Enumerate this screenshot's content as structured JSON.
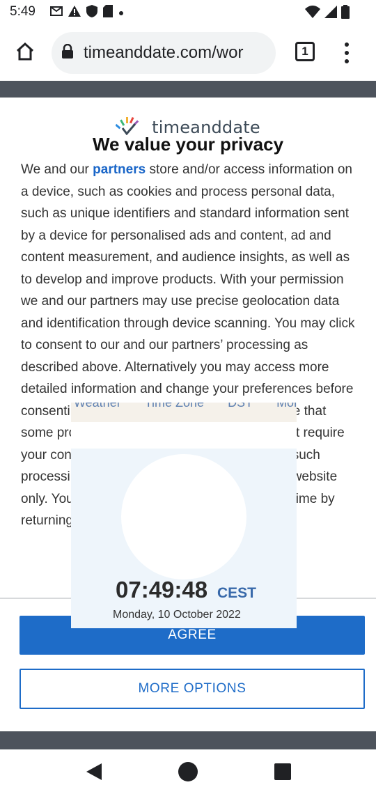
{
  "status_bar": {
    "time": "5:49",
    "icons_left": [
      "gmail-icon",
      "alert-icon",
      "shield-icon",
      "sd-card-icon",
      "dot-icon"
    ],
    "icons_right": [
      "wifi-icon",
      "signal-icon",
      "battery-icon"
    ]
  },
  "browser": {
    "url": "timeanddate.com/wor",
    "tab_count": "1"
  },
  "consent": {
    "logo_text": "timeanddate",
    "title": "We value your privacy",
    "text_before_link": "We and our ",
    "partners_link": "partners",
    "text_after_link": " store and/or access information on a device, such as cookies and process personal data, such as unique identifiers and standard information sent by a device for personalised ads and content, ad and content measurement, and audience insights, as well as to develop and improve products. With your permission we and our partners may use precise geolocation data and identification through device scanning. You may click to consent to our and our partners’ processing as described above. Alternatively you may access more detailed information and change your preferences before consenting or to refuse consenting. Please note that some processing of your personal data may not require your consent, but you have a right to object to such processing. Your preferences will apply to this website only. You can change your preferences at any time by returning",
    "agree_label": "AGREE",
    "more_options_label": "MORE OPTIONS"
  },
  "widget": {
    "tabs": [
      "Weather",
      "Time Zone",
      "DST",
      "More"
    ],
    "time": "07:49:48",
    "zone": "CEST",
    "date": "Monday, 10 October 2022"
  }
}
